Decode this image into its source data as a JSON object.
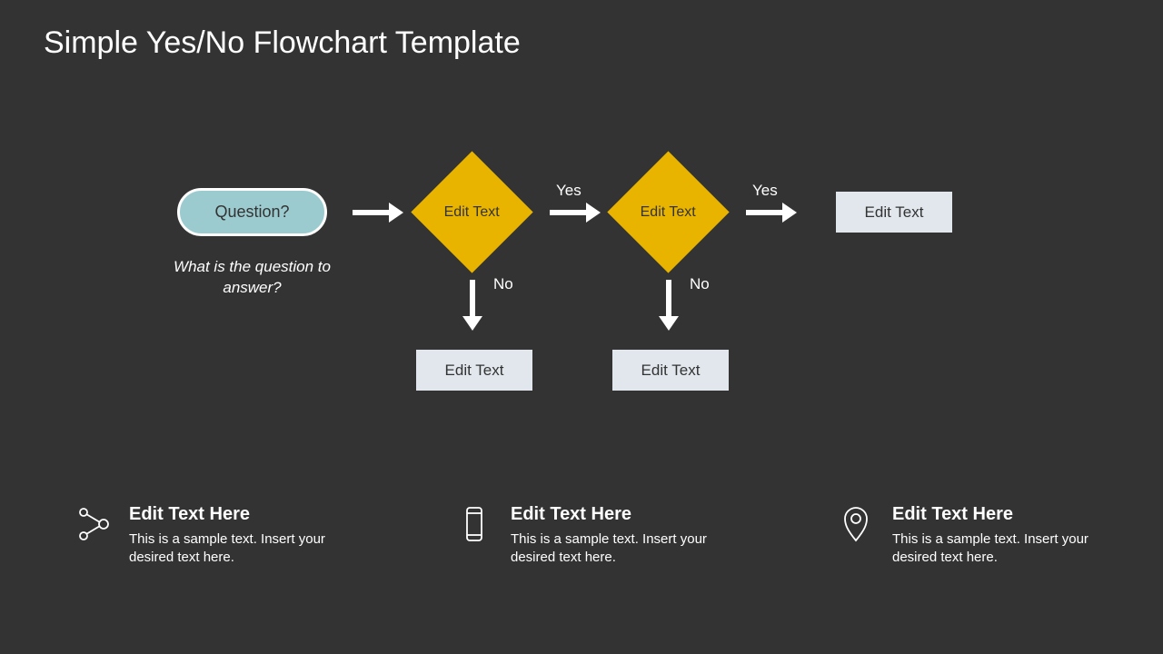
{
  "chart_data": {
    "type": "flowchart",
    "title": "Simple Yes/No Flowchart Template",
    "nodes": [
      {
        "id": "start",
        "shape": "terminator",
        "text": "Question?",
        "subtitle": "What is the question to answer?"
      },
      {
        "id": "d1",
        "shape": "decision",
        "text": "Edit Text"
      },
      {
        "id": "d2",
        "shape": "decision",
        "text": "Edit Text"
      },
      {
        "id": "end",
        "shape": "process",
        "text": "Edit Text"
      },
      {
        "id": "no1",
        "shape": "process",
        "text": "Edit Text"
      },
      {
        "id": "no2",
        "shape": "process",
        "text": "Edit Text"
      }
    ],
    "edges": [
      {
        "from": "start",
        "to": "d1",
        "label": ""
      },
      {
        "from": "d1",
        "to": "d2",
        "label": "Yes"
      },
      {
        "from": "d2",
        "to": "end",
        "label": "Yes"
      },
      {
        "from": "d1",
        "to": "no1",
        "label": "No"
      },
      {
        "from": "d2",
        "to": "no2",
        "label": "No"
      }
    ]
  },
  "labels": {
    "yes": "Yes",
    "no": "No"
  },
  "callouts": [
    {
      "icon": "share-icon",
      "heading": "Edit Text Here",
      "body": "This is a sample text. Insert your desired text here."
    },
    {
      "icon": "phone-icon",
      "heading": "Edit Text Here",
      "body": "This is a sample text. Insert your desired text here."
    },
    {
      "icon": "location-icon",
      "heading": "Edit Text Here",
      "body": "This is a sample text. Insert your desired text here."
    }
  ]
}
